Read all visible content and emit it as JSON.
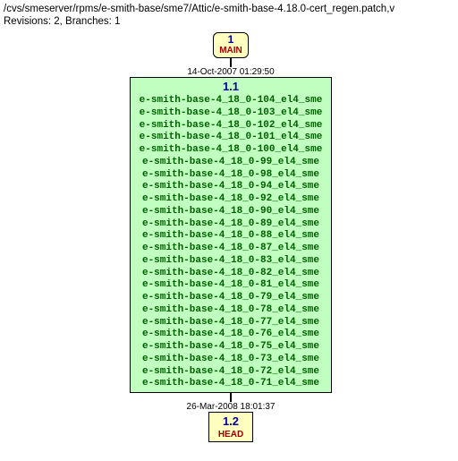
{
  "header": {
    "path": "/cvs/smeserver/rpms/e-smith-base/sme7/Attic/e-smith-base-4.18.0-cert_regen.patch,v",
    "stats": "Revisions: 2, Branches: 1"
  },
  "branch": {
    "num": "1",
    "label": "MAIN"
  },
  "rev1": {
    "timestamp": "14-Oct-2007 01:29:50",
    "num": "1.1",
    "tags": [
      "e-smith-base-4_18_0-104_el4_sme",
      "e-smith-base-4_18_0-103_el4_sme",
      "e-smith-base-4_18_0-102_el4_sme",
      "e-smith-base-4_18_0-101_el4_sme",
      "e-smith-base-4_18_0-100_el4_sme",
      "e-smith-base-4_18_0-99_el4_sme",
      "e-smith-base-4_18_0-98_el4_sme",
      "e-smith-base-4_18_0-94_el4_sme",
      "e-smith-base-4_18_0-92_el4_sme",
      "e-smith-base-4_18_0-90_el4_sme",
      "e-smith-base-4_18_0-89_el4_sme",
      "e-smith-base-4_18_0-88_el4_sme",
      "e-smith-base-4_18_0-87_el4_sme",
      "e-smith-base-4_18_0-83_el4_sme",
      "e-smith-base-4_18_0-82_el4_sme",
      "e-smith-base-4_18_0-81_el4_sme",
      "e-smith-base-4_18_0-79_el4_sme",
      "e-smith-base-4_18_0-78_el4_sme",
      "e-smith-base-4_18_0-77_el4_sme",
      "e-smith-base-4_18_0-76_el4_sme",
      "e-smith-base-4_18_0-75_el4_sme",
      "e-smith-base-4_18_0-73_el4_sme",
      "e-smith-base-4_18_0-72_el4_sme",
      "e-smith-base-4_18_0-71_el4_sme"
    ]
  },
  "rev2": {
    "timestamp": "26-Mar-2008 18:01:37",
    "num": "1.2",
    "head": "HEAD"
  }
}
